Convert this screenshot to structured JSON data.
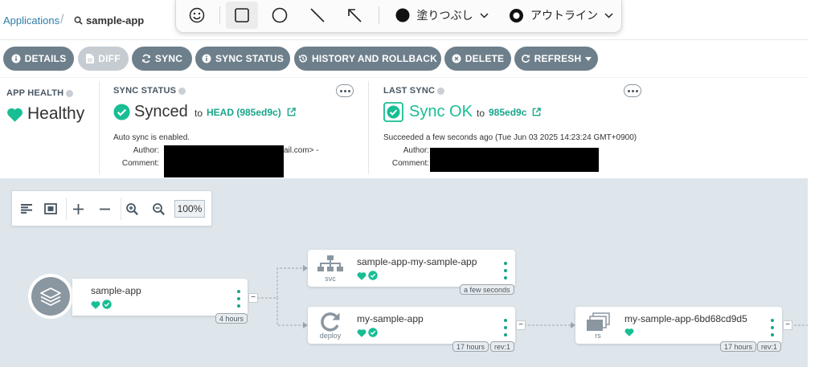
{
  "breadcrumb": {
    "applications": "Applications",
    "separator": "/",
    "app": "sample-app"
  },
  "drawing_toolbar": {
    "tools": [
      "smiley-icon",
      "square-icon",
      "circle-icon",
      "line-icon",
      "arrow-icon"
    ],
    "fill_label": "塗りつぶし",
    "outline_label": "アウトライン"
  },
  "actions": {
    "details": "DETAILS",
    "diff": "DIFF",
    "sync": "SYNC",
    "sync_status": "SYNC STATUS",
    "history": "HISTORY AND ROLLBACK",
    "delete": "DELETE",
    "refresh": "REFRESH"
  },
  "app_health": {
    "title": "APP HEALTH",
    "value": "Healthy"
  },
  "sync_status": {
    "title": "SYNC STATUS",
    "value": "Synced",
    "to_label": "to",
    "target": "HEAD (985ed9c)",
    "auto_sync": "Auto sync is enabled.",
    "author_label": "Author:",
    "comment_label": "Comment:",
    "author_suffix": "ail.com> -"
  },
  "last_sync": {
    "title": "LAST SYNC",
    "value": "Sync OK",
    "to_label": "to",
    "target": "985ed9c",
    "succeeded": "Succeeded a few seconds ago (Tue Jun 03 2025 14:23:24 GMT+0900)",
    "author_label": "Author:",
    "comment_label": "Comment:"
  },
  "zoom": {
    "level": "100%"
  },
  "graph": {
    "app_node": {
      "name": "sample-app",
      "age": "4 hours"
    },
    "svc_node": {
      "name": "sample-app-my-sample-app",
      "kind": "svc",
      "age": "a few seconds"
    },
    "deploy_node": {
      "name": "my-sample-app",
      "kind": "deploy",
      "age": "17 hours",
      "rev": "rev:1"
    },
    "rs_node": {
      "name": "my-sample-app-6bd68cd9d5",
      "kind": "rs",
      "age": "17 hours",
      "rev": "rev:1"
    },
    "toggle_symbol": "−"
  },
  "colors": {
    "accent": "#18be94",
    "button": "#6d7f8b",
    "canvas": "#dee6eb",
    "link": "#2c7ea8"
  }
}
